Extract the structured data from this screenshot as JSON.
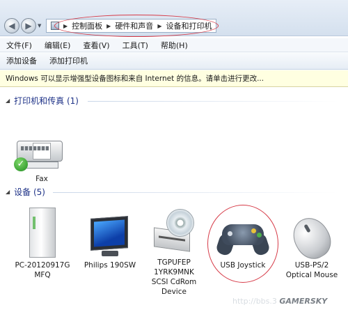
{
  "breadcrumb": [
    "控制面板",
    "硬件和声音",
    "设备和打印机"
  ],
  "menu": [
    "文件(F)",
    "编辑(E)",
    "查看(V)",
    "工具(T)",
    "帮助(H)"
  ],
  "toolbar": {
    "add_device": "添加设备",
    "add_printer": "添加打印机"
  },
  "infobar": "Windows 可以显示增强型设备图标和来自 Internet 的信息。请单击进行更改...",
  "printers_group": {
    "title": "打印机和传真 (1)",
    "items": [
      {
        "label": "Fax",
        "icon": "fax-icon"
      }
    ]
  },
  "devices_group": {
    "title": "设备 (5)",
    "items": [
      {
        "label_lines": [
          "PC-20120917G",
          "MFQ"
        ],
        "icon": "computer-icon"
      },
      {
        "label_lines": [
          "Philips 190SW"
        ],
        "icon": "monitor-icon"
      },
      {
        "label_lines": [
          "TGPUFEP",
          "1YRK9MNK",
          "SCSI CdRom",
          "Device"
        ],
        "icon": "cdrom-drive-icon"
      },
      {
        "label_lines": [
          "USB Joystick"
        ],
        "icon": "gamepad-icon"
      },
      {
        "label_lines": [
          "USB-PS/2",
          "Optical Mouse"
        ],
        "icon": "mouse-icon"
      }
    ]
  },
  "watermark": {
    "url": "http://bbs.3",
    "brand": "GAMERSKY"
  },
  "colors": {
    "annotation": "#d63a47",
    "group_title": "#1e3287",
    "infobar_bg": "#ffffe1"
  }
}
